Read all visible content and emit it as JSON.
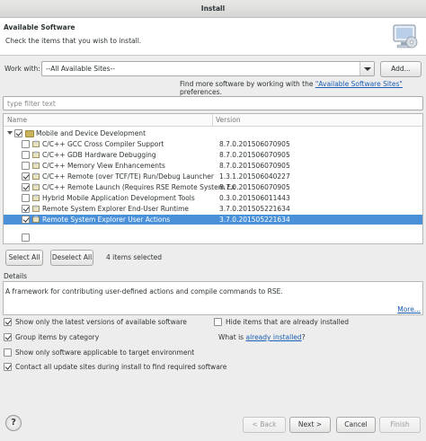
{
  "window": {
    "title": "Install"
  },
  "header": {
    "title": "Available Software",
    "description": "Check the items that you wish to install.",
    "icon": "install-wizard-icon"
  },
  "work_with": {
    "label": "Work with:",
    "value": "--All Available Sites--",
    "add_label": "Add..."
  },
  "info": {
    "prefix": "Find more software by working with the ",
    "link": "\"Available Software Sites\"",
    "suffix": " preferences."
  },
  "filter": {
    "placeholder": "type filter text"
  },
  "table": {
    "columns": [
      "Name",
      "Version"
    ],
    "rows": [
      {
        "name": "Mobile and Device Development",
        "version": "",
        "checked": true,
        "level": 0,
        "category": true,
        "selected": false
      },
      {
        "name": "C/C++ GCC Cross Compiler Support",
        "version": "8.7.0.201506070905",
        "checked": false,
        "level": 1,
        "selected": false
      },
      {
        "name": "C/C++ GDB Hardware Debugging",
        "version": "8.7.0.201506070905",
        "checked": false,
        "level": 1,
        "selected": false
      },
      {
        "name": "C/C++ Memory View Enhancements",
        "version": "8.7.0.201506070905",
        "checked": false,
        "level": 1,
        "selected": false
      },
      {
        "name": "C/C++ Remote (over TCF/TE) Run/Debug Launcher",
        "version": "1.3.1.201506040227",
        "checked": true,
        "level": 1,
        "selected": false
      },
      {
        "name": "C/C++ Remote Launch (Requires RSE Remote System Ex",
        "version": "8.7.0.201506070905",
        "checked": true,
        "level": 1,
        "selected": false
      },
      {
        "name": "Hybrid Mobile Application Development Tools",
        "version": "0.3.0.201506011443",
        "checked": false,
        "level": 1,
        "selected": false
      },
      {
        "name": "Remote System Explorer End-User Runtime",
        "version": "3.7.0.201505221634",
        "checked": true,
        "level": 1,
        "selected": false
      },
      {
        "name": "Remote System Explorer User Actions",
        "version": "3.7.0.201505221634",
        "checked": true,
        "level": 1,
        "selected": true
      }
    ]
  },
  "selection": {
    "select_all_label": "Select All",
    "deselect_all_label": "Deselect All",
    "count_text": "4 items selected"
  },
  "details": {
    "label": "Details",
    "text": "A framework for contributing user-defined actions and compile commands to RSE.",
    "more_label": "More..."
  },
  "options": {
    "latest_only": "Show only the latest versions of available software",
    "group_by_category": "Group items by category",
    "applicable_only": "Show only software applicable to target environment",
    "contact_all": "Contact all update sites during install to find required software",
    "hide_installed": "Hide items that are already installed",
    "what_is_prefix": "What is ",
    "what_is_link": "already installed",
    "what_is_suffix": "?"
  },
  "buttons": {
    "back": "< Back",
    "next": "Next >",
    "cancel": "Cancel",
    "finish": "Finish",
    "help": "?"
  },
  "colors": {
    "selection": "#4a90d9",
    "link": "#1a5fb4"
  }
}
